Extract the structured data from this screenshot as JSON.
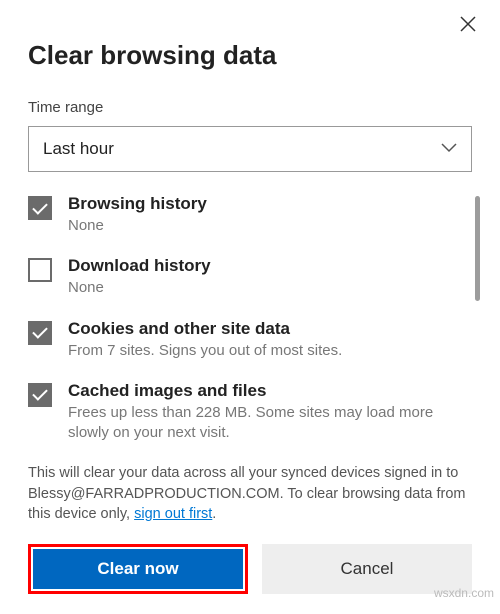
{
  "title": "Clear browsing data",
  "timeRange": {
    "label": "Time range",
    "selected": "Last hour"
  },
  "items": [
    {
      "checked": true,
      "title": "Browsing history",
      "desc": "None"
    },
    {
      "checked": false,
      "title": "Download history",
      "desc": "None"
    },
    {
      "checked": true,
      "title": "Cookies and other site data",
      "desc": "From 7 sites. Signs you out of most sites."
    },
    {
      "checked": true,
      "title": "Cached images and files",
      "desc": "Frees up less than 228 MB. Some sites may load more slowly on your next visit."
    }
  ],
  "info": {
    "prefix": "This will clear your data across all your synced devices signed in to Blessy@FARRADPRODUCTION.COM. To clear browsing data from this device only, ",
    "link": "sign out first",
    "suffix": "."
  },
  "buttons": {
    "primary": "Clear now",
    "secondary": "Cancel"
  },
  "watermark": "wsxdn.com"
}
